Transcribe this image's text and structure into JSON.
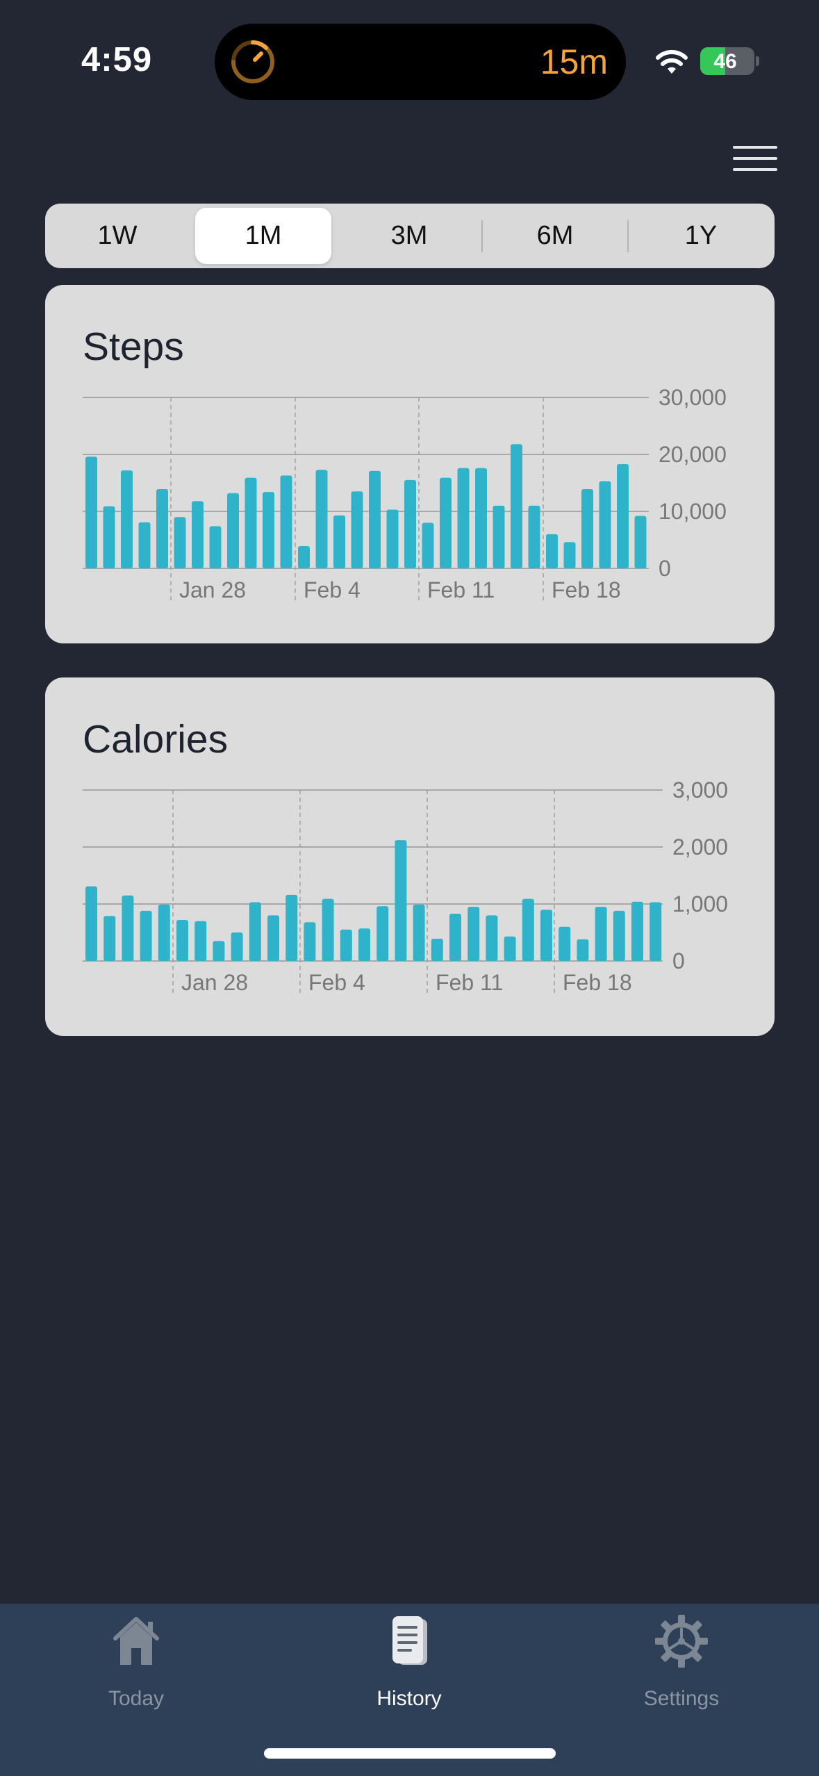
{
  "status_bar": {
    "time": "4:59",
    "live_activity_timer": "15m",
    "battery_level": "46",
    "battery_fraction": 0.46,
    "icons": [
      "timer-ring-icon",
      "wifi-icon",
      "battery-charging-icon"
    ]
  },
  "header": {
    "menu_icon": "hamburger-menu-icon"
  },
  "range_selector": {
    "options": [
      "1W",
      "1M",
      "3M",
      "6M",
      "1Y"
    ],
    "selected": "1M"
  },
  "colors": {
    "background": "#222733",
    "card": "#dcdcdc",
    "bar": "#2fb3cb",
    "accent_orange": "#f3a43a",
    "tab_bar": "#2d4057"
  },
  "chart_data": [
    {
      "type": "bar",
      "title": "Steps",
      "x_ticks": [
        "Jan 28",
        "Feb 4",
        "Feb 11",
        "Feb 18"
      ],
      "y_ticks": [
        "0",
        "10,000",
        "20,000",
        "30,000"
      ],
      "ylim": [
        0,
        30000
      ],
      "grid": true,
      "values": [
        19600,
        10900,
        17200,
        8100,
        13900,
        9000,
        11800,
        7400,
        13200,
        15900,
        13400,
        16300,
        3900,
        17300,
        9300,
        13500,
        17100,
        10300,
        15500,
        8000,
        15900,
        17600,
        17600,
        11000,
        21800,
        11000,
        6000,
        4600,
        13900,
        15300,
        18300,
        9200
      ]
    },
    {
      "type": "bar",
      "title": "Calories",
      "x_ticks": [
        "Jan 28",
        "Feb 4",
        "Feb 11",
        "Feb 18"
      ],
      "y_ticks": [
        "0",
        "1,000",
        "2,000",
        "3,000"
      ],
      "ylim": [
        0,
        3000
      ],
      "grid": true,
      "values": [
        1310,
        790,
        1150,
        880,
        990,
        720,
        700,
        350,
        500,
        1030,
        800,
        1160,
        680,
        1090,
        550,
        570,
        960,
        2120,
        990,
        390,
        830,
        950,
        800,
        430,
        1090,
        900,
        600,
        380,
        950,
        880,
        1040,
        1030
      ]
    }
  ],
  "tab_bar": {
    "items": [
      {
        "label": "Today",
        "icon": "house-icon",
        "active": false
      },
      {
        "label": "History",
        "icon": "document-icon",
        "active": true
      },
      {
        "label": "Settings",
        "icon": "gear-icon",
        "active": false
      }
    ]
  }
}
